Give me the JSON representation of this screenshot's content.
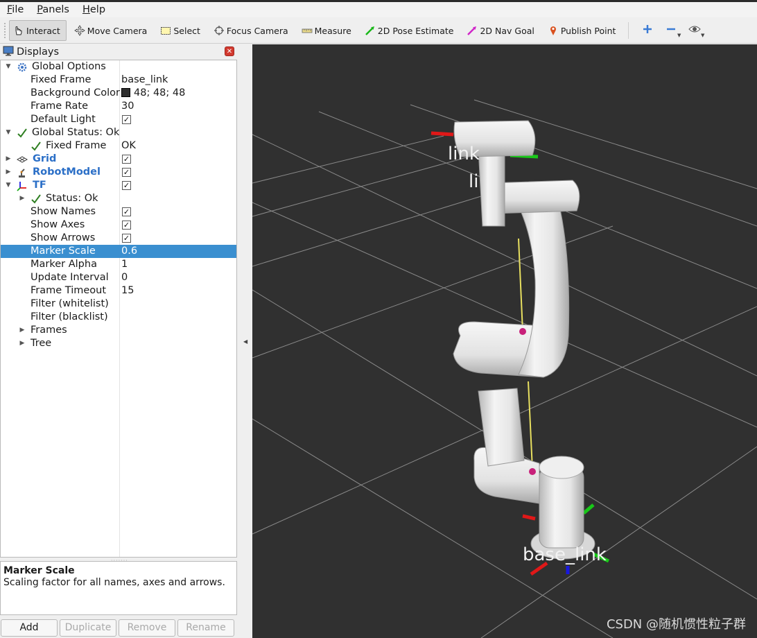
{
  "menubar": {
    "items": [
      {
        "label": "File",
        "mnemonic": "F",
        "rest": "ile"
      },
      {
        "label": "Panels",
        "mnemonic": "P",
        "rest": "anels"
      },
      {
        "label": "Help",
        "mnemonic": "H",
        "rest": "elp"
      }
    ]
  },
  "toolbar": {
    "interact": "Interact",
    "move_camera": "Move Camera",
    "select": "Select",
    "focus_camera": "Focus Camera",
    "measure": "Measure",
    "pose_estimate": "2D Pose Estimate",
    "nav_goal": "2D Nav Goal",
    "publish_point": "Publish Point"
  },
  "displays_panel": {
    "title": "Displays",
    "rows": {
      "global_options": "Global Options",
      "fixed_frame": {
        "name": "Fixed Frame",
        "value": "base_link"
      },
      "background_color": {
        "name": "Background Color",
        "value": "48; 48; 48",
        "swatch": "#303030"
      },
      "frame_rate": {
        "name": "Frame Rate",
        "value": "30"
      },
      "default_light": {
        "name": "Default Light",
        "checked": true
      },
      "global_status": "Global Status: Ok",
      "status_fixed_frame": {
        "name": "Fixed Frame",
        "value": "OK"
      },
      "grid": {
        "name": "Grid",
        "checked": true
      },
      "robot_model": {
        "name": "RobotModel",
        "checked": true
      },
      "tf": {
        "name": "TF",
        "checked": true
      },
      "tf_status": "Status: Ok",
      "show_names": {
        "name": "Show Names",
        "checked": true
      },
      "show_axes": {
        "name": "Show Axes",
        "checked": true
      },
      "show_arrows": {
        "name": "Show Arrows",
        "checked": true
      },
      "marker_scale": {
        "name": "Marker Scale",
        "value": "0.6"
      },
      "marker_alpha": {
        "name": "Marker Alpha",
        "value": "1"
      },
      "update_interval": {
        "name": "Update Interval",
        "value": "0"
      },
      "frame_timeout": {
        "name": "Frame Timeout",
        "value": "15"
      },
      "filter_whitelist": "Filter (whitelist)",
      "filter_blacklist": "Filter (blacklist)",
      "frames": "Frames",
      "tree": "Tree"
    },
    "check_glyph": "✓",
    "description": {
      "title": "Marker Scale",
      "text": "Scaling factor for all names, axes and arrows."
    },
    "buttons": {
      "add": "Add",
      "duplicate": "Duplicate",
      "remove": "Remove",
      "rename": "Rename"
    }
  },
  "viewport": {
    "background": "#303030",
    "labels": {
      "link_top": "link",
      "link_mid": "li",
      "base": "base_link"
    },
    "watermark": "CSDN @随机惯性粒子群"
  },
  "colors": {
    "selection": "#3a8fd0",
    "link_blue": "#2b6fc7",
    "axis_x": "#e01818",
    "axis_y": "#18c818",
    "axis_z": "#1818e0",
    "tf_arrow": "#e8e060",
    "frame_joint": "#c8207a"
  }
}
